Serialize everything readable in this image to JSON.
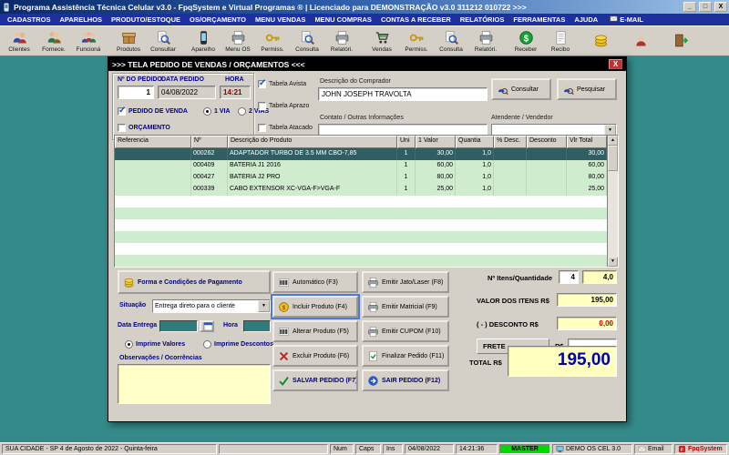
{
  "titlebar": {
    "title": "Programa Assistência Técnica Celular v3.0 - FpqSystem e Virtual Programas ®  | Licenciado para  DEMONSTRAÇÃO v3.0 311212 010722 >>>",
    "minimize": "_",
    "maximize": "□",
    "close": "X"
  },
  "menubar": {
    "items": [
      "CADASTROS",
      "APARELHOS",
      "PRODUTO/ESTOQUE",
      "OS/ORÇAMENTO",
      "MENU VENDAS",
      "MENU COMPRAS",
      "CONTAS A RECEBER",
      "RELATÓRIOS",
      "FERRAMENTAS",
      "AJUDA"
    ],
    "email": "E-MAIL"
  },
  "toolbar": {
    "items": [
      {
        "label": "Clientes",
        "icon": "clients-icon"
      },
      {
        "label": "Fornece.",
        "icon": "suppliers-icon"
      },
      {
        "label": "Funcioná",
        "icon": "employees-icon"
      },
      {
        "label": "Produtos",
        "icon": "products-icon"
      },
      {
        "label": "Consultar",
        "icon": "search-doc-icon"
      },
      {
        "label": "Aparelho",
        "icon": "cellphone-icon"
      },
      {
        "label": "Menu OS",
        "icon": "printer-icon"
      },
      {
        "label": "Permiss.",
        "icon": "key-icon"
      },
      {
        "label": "Consulta",
        "icon": "search-doc-icon"
      },
      {
        "label": "Relatóri.",
        "icon": "printer-icon"
      },
      {
        "label": "Vendas",
        "icon": "cart-icon"
      },
      {
        "label": "Permiss.",
        "icon": "key-icon"
      },
      {
        "label": "Consulta",
        "icon": "search-doc-icon"
      },
      {
        "label": "Relatóri.",
        "icon": "printer-icon"
      },
      {
        "label": "Receber",
        "icon": "dollar-icon"
      },
      {
        "label": "Recibo",
        "icon": "receipt-icon"
      },
      {
        "label": "",
        "icon": "coins-icon"
      },
      {
        "label": "",
        "icon": "person-icon"
      },
      {
        "label": "",
        "icon": "exit-door-icon"
      }
    ]
  },
  "dialog": {
    "title": ">>>   TELA PEDIDO DE VENDAS / ORÇAMENTOS   <<<",
    "close": "X",
    "header": {
      "numero_label": "Nº DO PEDIDO",
      "numero_value": "1",
      "data_label": "DATA PEDIDO",
      "data_value": "04/08/2022",
      "hora_label": "HORA",
      "hora_value": "14:21",
      "pedido_venda_label": "PEDIDO DE VENDA",
      "pedido_venda_checked": true,
      "orcamento_label": "ORÇAMENTO",
      "orcamento_checked": false,
      "via1_label": "1 VIA",
      "via1_selected": true,
      "via2_label": "2 VIAS",
      "via2_selected": false,
      "tabelas": [
        {
          "label": "Tabela Avista",
          "checked": true
        },
        {
          "label": "Tabela Aprazo",
          "checked": false
        },
        {
          "label": "Tabela Atacado",
          "checked": false
        }
      ],
      "comprador_label": "Descrição do Comprador",
      "comprador_value": "JOHN JOSEPH TRAVOLTA",
      "contato_label": "Contato / Outras Informações",
      "contato_value": "",
      "consultar_label": "Consultar",
      "pesquisar_label": "Pesquisar",
      "atendente_label": "Atendente / Vendedor",
      "atendente_value": ""
    },
    "table": {
      "columns": [
        "Referencia",
        "Nº",
        "Descrição do Produto",
        "Uni",
        "1 Valor",
        "Quantia",
        "% Desc.",
        "Desconto",
        "Vlr Total"
      ],
      "rows": [
        {
          "selected": true,
          "cells": [
            "",
            "000262",
            "ADAPTADOR TURBO DE 3.5 MM CBO-7,85",
            "1",
            "30,00",
            "1,0",
            "",
            "",
            "30,00"
          ]
        },
        {
          "selected": false,
          "cells": [
            "",
            "000409",
            "BATERIA J1 2016",
            "1",
            "60,00",
            "1,0",
            "",
            "",
            "60,00"
          ]
        },
        {
          "selected": false,
          "cells": [
            "",
            "000427",
            "BATERIA J2 PRO",
            "1",
            "80,00",
            "1,0",
            "",
            "",
            "80,00"
          ]
        },
        {
          "selected": false,
          "cells": [
            "",
            "000339",
            "CABO EXTENSOR XC-VGA-F>VGA-F",
            "1",
            "25,00",
            "1,0",
            "",
            "",
            "25,00"
          ]
        }
      ]
    },
    "left": {
      "pagamento_label": "Forma e Condições de Pagamento",
      "situacao_label": "Situação",
      "situacao_value": "Entrega direto para o cliente",
      "data_entrega_label": "Data Entrega",
      "hora_entrega_label": "Hora",
      "imprime_valores_label": "Imprime Valores",
      "imprime_valores_selected": true,
      "imprime_descontos_label": "Imprime Descontos",
      "imprime_descontos_selected": false,
      "observacoes_label": "Observações / Ocorrências",
      "observacoes_value": ""
    },
    "mid_buttons": [
      {
        "label": "Automático  (F3)",
        "icon": "barcode-icon"
      },
      {
        "label": "Incluir Produto  (F4)",
        "icon": "coin-icon",
        "focused": true
      },
      {
        "label": "Alterar Produto  (F5)",
        "icon": "barcode-icon"
      },
      {
        "label": "Excluir Produto  (F6)",
        "icon": "delete-icon"
      },
      {
        "label": "SALVAR PEDIDO (F7)",
        "icon": "check-icon",
        "strong": true
      }
    ],
    "right_buttons": [
      {
        "label": "Emitir Jato/Laser  (F8)",
        "icon": "printer-icon"
      },
      {
        "label": "Emitir Matricial  (F9)",
        "icon": "printer-icon"
      },
      {
        "label": "Emitir CUPOM  (F10)",
        "icon": "printer-icon"
      },
      {
        "label": "Finalizar Pedido  (F11)",
        "icon": "finalize-icon"
      },
      {
        "label": "SAIR  PEDIDO  (F12)",
        "icon": "exit-blue-icon",
        "strong": true
      }
    ],
    "totals": {
      "itens_label": "Nº Itens/Quantidade",
      "itens_value": "4",
      "quantidade_value": "4,0",
      "valor_label": "VALOR DOS ITENS R$",
      "valor_value": "195,00",
      "desconto_label": "( - ) DESCONTO R$",
      "desconto_value": "0,00",
      "frete_label": "FRETE",
      "frete_rs_label": "R$",
      "frete_value": "",
      "total_label": "TOTAL R$",
      "total_value": "195,00"
    }
  },
  "statusbar": {
    "segments": [
      {
        "name": "location-date",
        "text": "SUA CIDADE - SP   4 de Agosto de 2022 - Quinta-feira"
      },
      {
        "name": "spacer",
        "text": ""
      },
      {
        "name": "num-lock",
        "text": "Num"
      },
      {
        "name": "caps-lock",
        "text": "Caps"
      },
      {
        "name": "insert",
        "text": "Ins"
      },
      {
        "name": "date",
        "text": "04/08/2022"
      },
      {
        "name": "time",
        "text": "14:21:36"
      },
      {
        "name": "user-level",
        "text": "MASTER",
        "highlight": true
      },
      {
        "name": "app-version",
        "text": "DEMO OS CEL 3.0",
        "icon": "monitor-icon"
      },
      {
        "name": "email",
        "text": "Email",
        "icon": "mail-icon"
      },
      {
        "name": "brand",
        "text": "FpqSystem",
        "brand": true,
        "icon": "logo-icon"
      }
    ]
  }
}
